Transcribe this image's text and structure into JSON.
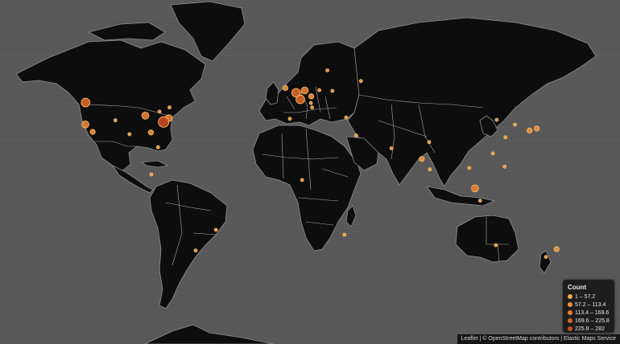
{
  "legend": {
    "title": "Count",
    "classes": [
      {
        "label": "1 – 57.2",
        "color": "#f0a451"
      },
      {
        "label": "57.2 – 113.4",
        "color": "#ed9342"
      },
      {
        "label": "113.4 – 169.6",
        "color": "#e57e34"
      },
      {
        "label": "169.6 – 225.8",
        "color": "#d8652a"
      },
      {
        "label": "225.8 – 282",
        "color": "#c64b22"
      }
    ]
  },
  "attribution": {
    "leaflet": "Leaflet",
    "sep1": " | © ",
    "osm": "OpenStreetMap contributors",
    "sep2": " | ",
    "ems": "Elastic Maps Service"
  },
  "markers": [
    {
      "name": "seattle",
      "lat": 47.6,
      "lon": -122.3,
      "cls": 3
    },
    {
      "name": "san-francisco",
      "lat": 37.7,
      "lon": -122.4,
      "cls": 2
    },
    {
      "name": "los-angeles",
      "lat": 34.0,
      "lon": -118.2,
      "cls": 1
    },
    {
      "name": "denver",
      "lat": 39.7,
      "lon": -105.0,
      "cls": 0
    },
    {
      "name": "dallas",
      "lat": 32.8,
      "lon": -96.8,
      "cls": 0
    },
    {
      "name": "chicago",
      "lat": 41.9,
      "lon": -87.6,
      "cls": 2
    },
    {
      "name": "toronto",
      "lat": 43.7,
      "lon": -79.4,
      "cls": 0
    },
    {
      "name": "new-york",
      "lat": 40.7,
      "lon": -74.0,
      "cls": 2
    },
    {
      "name": "washington",
      "lat": 38.9,
      "lon": -77.0,
      "cls": 4
    },
    {
      "name": "atlanta",
      "lat": 33.7,
      "lon": -84.4,
      "cls": 1
    },
    {
      "name": "miami",
      "lat": 25.8,
      "lon": -80.2,
      "cls": 0
    },
    {
      "name": "montreal",
      "lat": 45.5,
      "lon": -73.6,
      "cls": 0
    },
    {
      "name": "san-jose-cr",
      "lat": 9.9,
      "lon": -84.1,
      "cls": 0
    },
    {
      "name": "sao-paulo",
      "lat": -23.5,
      "lon": -46.6,
      "cls": 0
    },
    {
      "name": "buenos-aires",
      "lat": -34.6,
      "lon": -58.4,
      "cls": 0
    },
    {
      "name": "dublin",
      "lat": 53.3,
      "lon": -6.3,
      "cls": 1
    },
    {
      "name": "london",
      "lat": 51.5,
      "lon": -0.1,
      "cls": 3
    },
    {
      "name": "amsterdam",
      "lat": 52.4,
      "lon": 4.9,
      "cls": 2
    },
    {
      "name": "paris",
      "lat": 48.9,
      "lon": 2.4,
      "cls": 3
    },
    {
      "name": "frankfurt",
      "lat": 50.1,
      "lon": 8.7,
      "cls": 1
    },
    {
      "name": "berlin",
      "lat": 52.5,
      "lon": 13.4,
      "cls": 0
    },
    {
      "name": "stockholm",
      "lat": 59.3,
      "lon": 18.1,
      "cls": 0
    },
    {
      "name": "zurich",
      "lat": 47.4,
      "lon": 8.5,
      "cls": 0
    },
    {
      "name": "milan",
      "lat": 45.5,
      "lon": 9.2,
      "cls": 0
    },
    {
      "name": "madrid",
      "lat": 40.4,
      "lon": -3.7,
      "cls": 0
    },
    {
      "name": "warsaw",
      "lat": 52.2,
      "lon": 21.0,
      "cls": 0
    },
    {
      "name": "moscow",
      "lat": 55.8,
      "lon": 37.6,
      "cls": 0
    },
    {
      "name": "istanbul",
      "lat": 41.0,
      "lon": 29.0,
      "cls": 0
    },
    {
      "name": "tel-aviv",
      "lat": 32.1,
      "lon": 34.8,
      "cls": 0
    },
    {
      "name": "dubai",
      "lat": 25.2,
      "lon": 55.3,
      "cls": 0
    },
    {
      "name": "mumbai",
      "lat": 19.1,
      "lon": 72.9,
      "cls": 1
    },
    {
      "name": "bangalore",
      "lat": 13.0,
      "lon": 77.6,
      "cls": 0
    },
    {
      "name": "delhi",
      "lat": 28.6,
      "lon": 77.2,
      "cls": 0
    },
    {
      "name": "bangkok",
      "lat": 13.8,
      "lon": 100.5,
      "cls": 0
    },
    {
      "name": "singapore",
      "lat": 1.4,
      "lon": 103.8,
      "cls": 2
    },
    {
      "name": "jakarta",
      "lat": -6.2,
      "lon": 106.8,
      "cls": 0
    },
    {
      "name": "manila",
      "lat": 14.6,
      "lon": 121.0,
      "cls": 0
    },
    {
      "name": "hong-kong",
      "lat": 22.3,
      "lon": 114.2,
      "cls": 0
    },
    {
      "name": "shanghai",
      "lat": 31.2,
      "lon": 121.5,
      "cls": 0
    },
    {
      "name": "beijing",
      "lat": 39.9,
      "lon": 116.4,
      "cls": 0
    },
    {
      "name": "seoul",
      "lat": 37.6,
      "lon": 127.0,
      "cls": 0
    },
    {
      "name": "tokyo",
      "lat": 35.7,
      "lon": 139.7,
      "cls": 1
    },
    {
      "name": "osaka",
      "lat": 34.7,
      "lon": 135.5,
      "cls": 1
    },
    {
      "name": "sydney",
      "lat": -33.9,
      "lon": 151.2,
      "cls": 1
    },
    {
      "name": "melbourne",
      "lat": -37.8,
      "lon": 145.0,
      "cls": 0
    },
    {
      "name": "perth",
      "lat": -31.9,
      "lon": 115.9,
      "cls": 0
    },
    {
      "name": "johannesburg",
      "lat": -26.2,
      "lon": 28.0,
      "cls": 0
    },
    {
      "name": "lagos",
      "lat": 6.5,
      "lon": 3.4,
      "cls": 0
    }
  ]
}
